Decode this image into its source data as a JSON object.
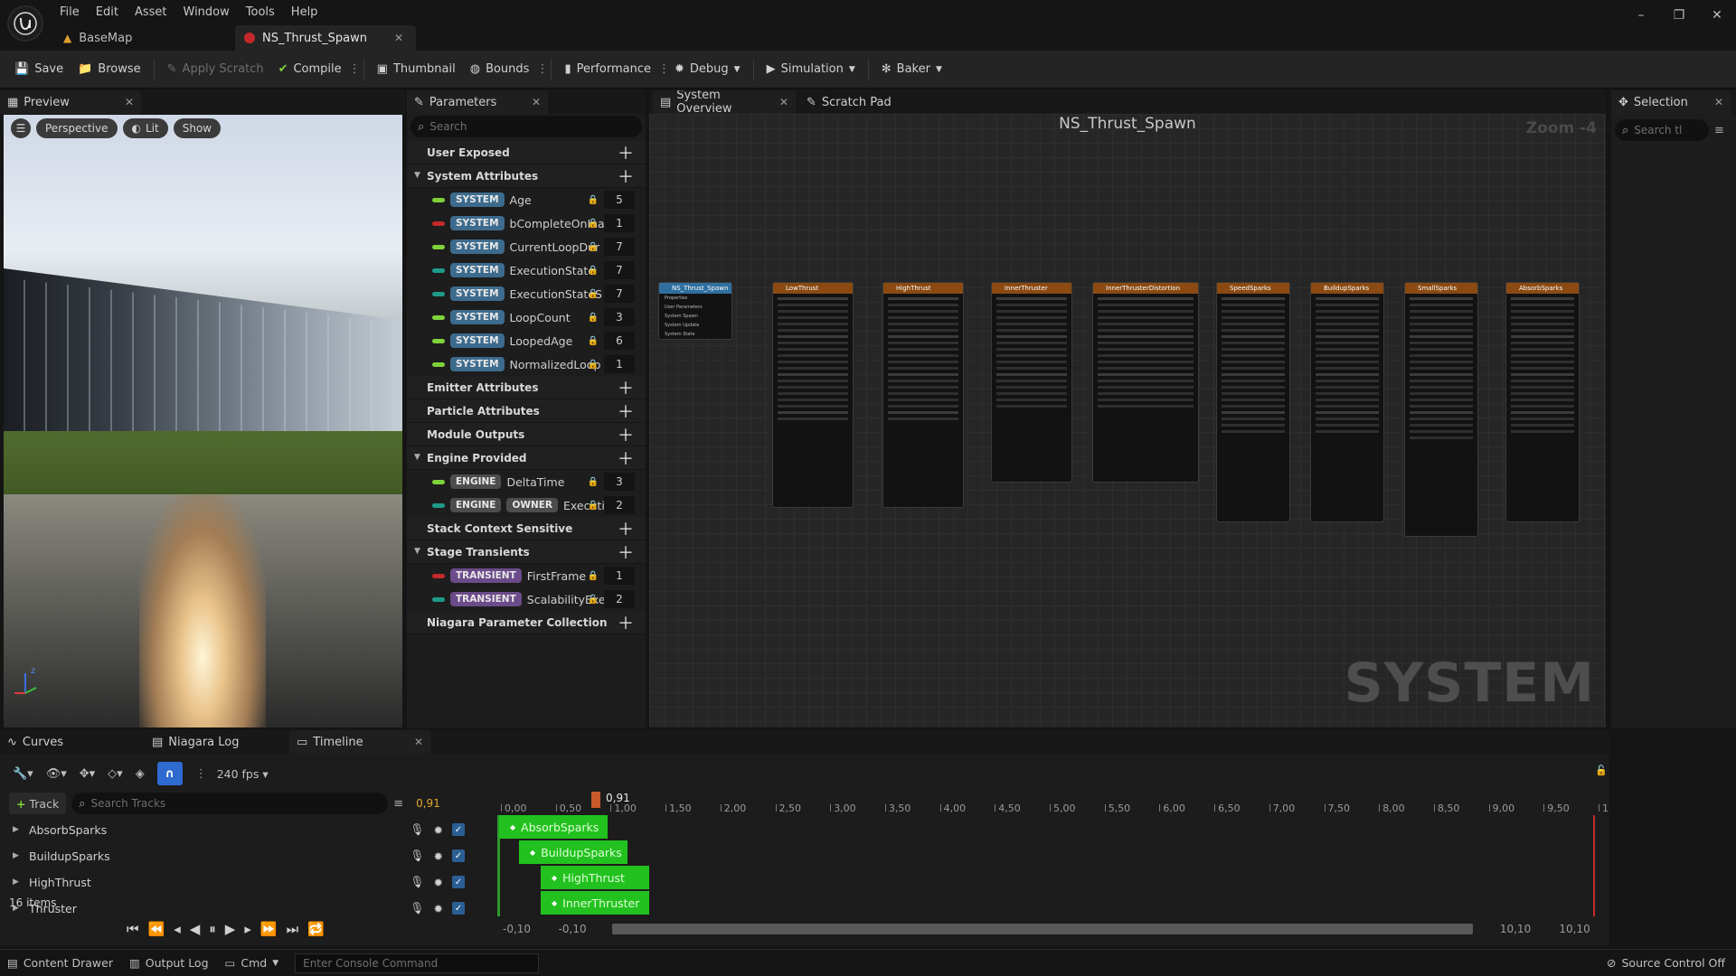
{
  "menu": [
    "File",
    "Edit",
    "Asset",
    "Window",
    "Tools",
    "Help"
  ],
  "doc_tabs": [
    {
      "label": "BaseMap"
    },
    {
      "label": "NS_Thrust_Spawn"
    }
  ],
  "toolbar": {
    "save": "Save",
    "browse": "Browse",
    "apply_scratch": "Apply Scratch",
    "compile": "Compile",
    "thumbnail": "Thumbnail",
    "bounds": "Bounds",
    "performance": "Performance",
    "debug": "Debug",
    "simulation": "Simulation",
    "baker": "Baker"
  },
  "preview": {
    "tab": "Preview",
    "perspective": "Perspective",
    "lit": "Lit",
    "show": "Show",
    "gizmo_z": "z"
  },
  "parameters": {
    "tab": "Parameters",
    "search_placeholder": "Search",
    "sections": {
      "user_exposed": "User Exposed",
      "system_attributes": "System Attributes",
      "emitter_attributes": "Emitter Attributes",
      "particle_attributes": "Particle Attributes",
      "module_outputs": "Module Outputs",
      "engine_provided": "Engine Provided",
      "stack_context": "Stack Context Sensitive",
      "stage_transients": "Stage Transients",
      "collection": "Niagara Parameter Collection"
    },
    "system_params": [
      {
        "badge": "SYSTEM",
        "name": "Age",
        "value": "5",
        "color": "#7fd23a"
      },
      {
        "badge": "SYSTEM",
        "name": "bCompleteOnIna",
        "value": "1",
        "color": "#c42a2a"
      },
      {
        "badge": "SYSTEM",
        "name": "CurrentLoopDur",
        "value": "7",
        "color": "#7fd23a"
      },
      {
        "badge": "SYSTEM",
        "name": "ExecutionState",
        "value": "7",
        "color": "#1f9a8a"
      },
      {
        "badge": "SYSTEM",
        "name": "ExecutionStateS",
        "value": "7",
        "color": "#1f9a8a"
      },
      {
        "badge": "SYSTEM",
        "name": "LoopCount",
        "value": "3",
        "color": "#7fd23a"
      },
      {
        "badge": "SYSTEM",
        "name": "LoopedAge",
        "value": "6",
        "color": "#7fd23a"
      },
      {
        "badge": "SYSTEM",
        "name": "NormalizedLoop",
        "value": "1",
        "color": "#7fd23a"
      }
    ],
    "engine_params": [
      {
        "badges": [
          "ENGINE"
        ],
        "name": "DeltaTime",
        "value": "3",
        "color": "#7fd23a"
      },
      {
        "badges": [
          "ENGINE",
          "OWNER"
        ],
        "name": "Executi",
        "value": "2",
        "color": "#1f9a8a"
      }
    ],
    "transient_params": [
      {
        "badge": "TRANSIENT",
        "name": "FirstFrame",
        "value": "1",
        "color": "#c42a2a"
      },
      {
        "badge": "TRANSIENT",
        "name": "ScalabilityExe",
        "value": "2",
        "color": "#1f9a8a"
      }
    ]
  },
  "graph": {
    "tabs": [
      "System Overview",
      "Scratch Pad"
    ],
    "title": "NS_Thrust_Spawn",
    "zoom": "Zoom -4",
    "watermark": "SYSTEM",
    "system_node": "NS_Thrust_Spawn",
    "system_node_rows": [
      "Properties",
      "User Parameters",
      "System Spawn",
      "System Update",
      "System State"
    ],
    "emitters": [
      "LowThrust",
      "HighThrust",
      "InnerThruster",
      "InnerThrusterDistortion",
      "SpeedSparks",
      "BuildupSparks",
      "SmallSparks",
      "AbsorbSparks"
    ]
  },
  "selection": {
    "tab": "Selection",
    "search_placeholder": "Search tl"
  },
  "bottom": {
    "tabs": [
      "Curves",
      "Niagara Log",
      "Timeline"
    ],
    "fps": "240 fps",
    "add_track": "Track",
    "search_placeholder": "Search Tracks",
    "current_time": "0,91",
    "playhead": "0,91",
    "items_count": "16 items",
    "tracks": [
      "AbsorbSparks",
      "BuildupSparks",
      "HighThrust",
      "Thruster"
    ],
    "bars": [
      "AbsorbSparks",
      "BuildupSparks",
      "HighThrust",
      "InnerThruster"
    ],
    "ruler": [
      "0,00",
      "0,50",
      "1,00",
      "1,50",
      "2,00",
      "2,50",
      "3,00",
      "3,50",
      "4,00",
      "4,50",
      "5,00",
      "5,50",
      "6,00",
      "6,50",
      "7,00",
      "7,50",
      "8,00",
      "8,50",
      "9,00",
      "9,50",
      "1"
    ],
    "range_start": "-0,10",
    "range_start2": "-0,10",
    "range_end": "10,10",
    "range_end2": "10,10"
  },
  "status": {
    "content_drawer": "Content Drawer",
    "output_log": "Output Log",
    "cmd": "Cmd",
    "console_placeholder": "Enter Console Command",
    "source_control": "Source Control Off"
  }
}
